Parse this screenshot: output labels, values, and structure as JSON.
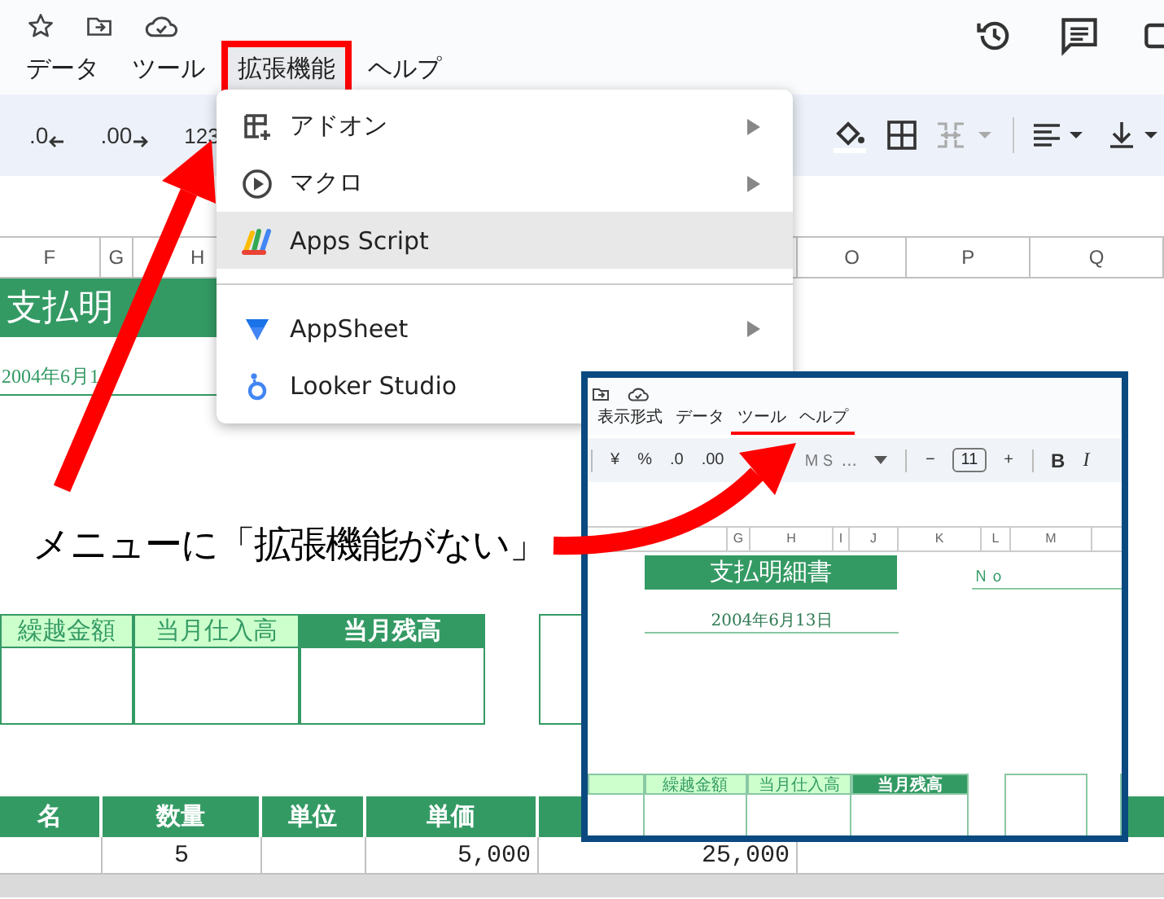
{
  "menu_bar": [
    {
      "label": "データ",
      "selected": false,
      "annotated": false
    },
    {
      "label": "ツール",
      "selected": false,
      "annotated": false
    },
    {
      "label": "拡張機能",
      "selected": true,
      "annotated": true
    },
    {
      "label": "ヘルプ",
      "selected": false,
      "annotated": false
    }
  ],
  "toolbar": {
    "decrease_decimal": ".0",
    "increase_decimal": ".00",
    "number_format": "123"
  },
  "columns": [
    "F",
    "G",
    "H",
    "O",
    "P",
    "Q"
  ],
  "sheet": {
    "title": "支払明",
    "date": "2004年6月1",
    "summary_headers": [
      {
        "label": "繰越金額",
        "kind": "light"
      },
      {
        "label": "当月仕入高",
        "kind": "light"
      },
      {
        "label": "当月残高",
        "kind": "dark"
      }
    ],
    "item_headers": [
      "名",
      "数量",
      "単位",
      "単価"
    ],
    "item_row": {
      "quantity": "5",
      "unit_price": "5,000",
      "column_5": "25,000"
    }
  },
  "annotation": "メニューに「拡張機能がない」",
  "dropdown_menu": [
    {
      "kind": "addon",
      "label": "アドオン",
      "submenu": true,
      "selected": false,
      "separator_before": false
    },
    {
      "kind": "macro",
      "label": "マクロ",
      "submenu": true,
      "selected": false,
      "separator_before": false
    },
    {
      "kind": "apps_script",
      "label": "Apps Script",
      "submenu": false,
      "selected": true,
      "separator_before": false
    },
    {
      "kind": "appsheet",
      "label": "AppSheet",
      "submenu": true,
      "selected": false,
      "separator_before": true
    },
    {
      "kind": "looker",
      "label": "Looker Studio",
      "submenu": false,
      "selected": false,
      "separator_before": false
    }
  ],
  "inset": {
    "menu": [
      {
        "label": "表示形式",
        "underlined": false
      },
      {
        "label": "データ",
        "underlined": false
      },
      {
        "label": "ツール",
        "underlined": true
      },
      {
        "label": "ヘルプ",
        "underlined": true
      }
    ],
    "toolbar": {
      "currency": "¥",
      "percent": "%",
      "decrease_decimal": ".0",
      "increase_decimal": ".00",
      "font": "ＭＳ ...",
      "minus": "−",
      "font_size": "11",
      "plus": "+",
      "bold": "B",
      "italic": "I"
    },
    "columns": [
      "G",
      "H",
      "I",
      "J",
      "K",
      "L",
      "M"
    ],
    "title": "支払明細書",
    "number_label": "Ｎｏ",
    "date": "2004年6月13日",
    "summary_headers": [
      {
        "label": "繰越金額",
        "kind": "light"
      },
      {
        "label": "当月仕入高",
        "kind": "light"
      },
      {
        "label": "当月残高",
        "kind": "dark"
      }
    ]
  }
}
